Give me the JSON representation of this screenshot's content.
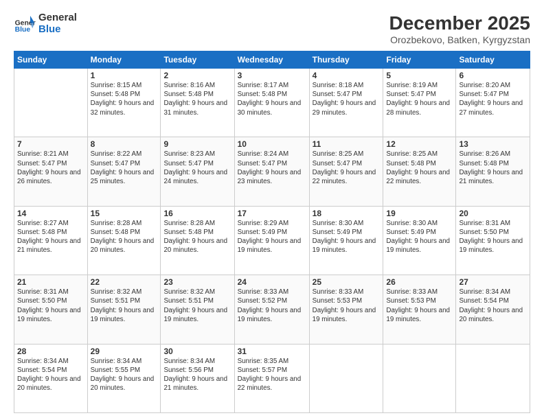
{
  "header": {
    "logo_general": "General",
    "logo_blue": "Blue",
    "title": "December 2025",
    "subtitle": "Orozbekovo, Batken, Kyrgyzstan"
  },
  "days_of_week": [
    "Sunday",
    "Monday",
    "Tuesday",
    "Wednesday",
    "Thursday",
    "Friday",
    "Saturday"
  ],
  "weeks": [
    [
      {
        "num": "",
        "info": ""
      },
      {
        "num": "1",
        "info": "Sunrise: 8:15 AM\nSunset: 5:48 PM\nDaylight: 9 hours\nand 32 minutes."
      },
      {
        "num": "2",
        "info": "Sunrise: 8:16 AM\nSunset: 5:48 PM\nDaylight: 9 hours\nand 31 minutes."
      },
      {
        "num": "3",
        "info": "Sunrise: 8:17 AM\nSunset: 5:48 PM\nDaylight: 9 hours\nand 30 minutes."
      },
      {
        "num": "4",
        "info": "Sunrise: 8:18 AM\nSunset: 5:47 PM\nDaylight: 9 hours\nand 29 minutes."
      },
      {
        "num": "5",
        "info": "Sunrise: 8:19 AM\nSunset: 5:47 PM\nDaylight: 9 hours\nand 28 minutes."
      },
      {
        "num": "6",
        "info": "Sunrise: 8:20 AM\nSunset: 5:47 PM\nDaylight: 9 hours\nand 27 minutes."
      }
    ],
    [
      {
        "num": "7",
        "info": "Sunrise: 8:21 AM\nSunset: 5:47 PM\nDaylight: 9 hours\nand 26 minutes."
      },
      {
        "num": "8",
        "info": "Sunrise: 8:22 AM\nSunset: 5:47 PM\nDaylight: 9 hours\nand 25 minutes."
      },
      {
        "num": "9",
        "info": "Sunrise: 8:23 AM\nSunset: 5:47 PM\nDaylight: 9 hours\nand 24 minutes."
      },
      {
        "num": "10",
        "info": "Sunrise: 8:24 AM\nSunset: 5:47 PM\nDaylight: 9 hours\nand 23 minutes."
      },
      {
        "num": "11",
        "info": "Sunrise: 8:25 AM\nSunset: 5:47 PM\nDaylight: 9 hours\nand 22 minutes."
      },
      {
        "num": "12",
        "info": "Sunrise: 8:25 AM\nSunset: 5:48 PM\nDaylight: 9 hours\nand 22 minutes."
      },
      {
        "num": "13",
        "info": "Sunrise: 8:26 AM\nSunset: 5:48 PM\nDaylight: 9 hours\nand 21 minutes."
      }
    ],
    [
      {
        "num": "14",
        "info": "Sunrise: 8:27 AM\nSunset: 5:48 PM\nDaylight: 9 hours\nand 21 minutes."
      },
      {
        "num": "15",
        "info": "Sunrise: 8:28 AM\nSunset: 5:48 PM\nDaylight: 9 hours\nand 20 minutes."
      },
      {
        "num": "16",
        "info": "Sunrise: 8:28 AM\nSunset: 5:48 PM\nDaylight: 9 hours\nand 20 minutes."
      },
      {
        "num": "17",
        "info": "Sunrise: 8:29 AM\nSunset: 5:49 PM\nDaylight: 9 hours\nand 19 minutes."
      },
      {
        "num": "18",
        "info": "Sunrise: 8:30 AM\nSunset: 5:49 PM\nDaylight: 9 hours\nand 19 minutes."
      },
      {
        "num": "19",
        "info": "Sunrise: 8:30 AM\nSunset: 5:49 PM\nDaylight: 9 hours\nand 19 minutes."
      },
      {
        "num": "20",
        "info": "Sunrise: 8:31 AM\nSunset: 5:50 PM\nDaylight: 9 hours\nand 19 minutes."
      }
    ],
    [
      {
        "num": "21",
        "info": "Sunrise: 8:31 AM\nSunset: 5:50 PM\nDaylight: 9 hours\nand 19 minutes."
      },
      {
        "num": "22",
        "info": "Sunrise: 8:32 AM\nSunset: 5:51 PM\nDaylight: 9 hours\nand 19 minutes."
      },
      {
        "num": "23",
        "info": "Sunrise: 8:32 AM\nSunset: 5:51 PM\nDaylight: 9 hours\nand 19 minutes."
      },
      {
        "num": "24",
        "info": "Sunrise: 8:33 AM\nSunset: 5:52 PM\nDaylight: 9 hours\nand 19 minutes."
      },
      {
        "num": "25",
        "info": "Sunrise: 8:33 AM\nSunset: 5:53 PM\nDaylight: 9 hours\nand 19 minutes."
      },
      {
        "num": "26",
        "info": "Sunrise: 8:33 AM\nSunset: 5:53 PM\nDaylight: 9 hours\nand 19 minutes."
      },
      {
        "num": "27",
        "info": "Sunrise: 8:34 AM\nSunset: 5:54 PM\nDaylight: 9 hours\nand 20 minutes."
      }
    ],
    [
      {
        "num": "28",
        "info": "Sunrise: 8:34 AM\nSunset: 5:54 PM\nDaylight: 9 hours\nand 20 minutes."
      },
      {
        "num": "29",
        "info": "Sunrise: 8:34 AM\nSunset: 5:55 PM\nDaylight: 9 hours\nand 20 minutes."
      },
      {
        "num": "30",
        "info": "Sunrise: 8:34 AM\nSunset: 5:56 PM\nDaylight: 9 hours\nand 21 minutes."
      },
      {
        "num": "31",
        "info": "Sunrise: 8:35 AM\nSunset: 5:57 PM\nDaylight: 9 hours\nand 22 minutes."
      },
      {
        "num": "",
        "info": ""
      },
      {
        "num": "",
        "info": ""
      },
      {
        "num": "",
        "info": ""
      }
    ]
  ]
}
